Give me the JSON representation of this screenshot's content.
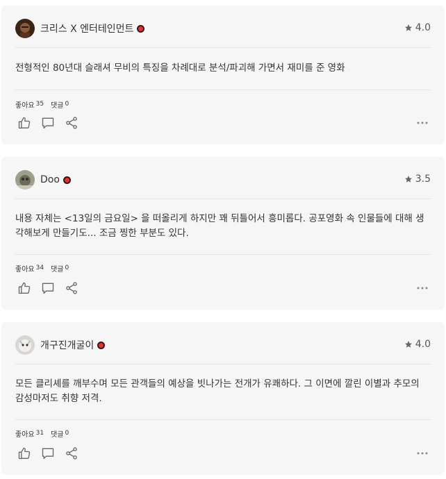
{
  "reviews": [
    {
      "username": "크리스 X 엔터테인먼트",
      "rating": "4.0",
      "text": "전형적인 80년대 슬래셔 무비의 특징을 차례대로 분석/파괴해 가면서 재미를 준 영화",
      "likes_label": "좋아요",
      "likes": "35",
      "comments_label": "댓글",
      "comments": "0"
    },
    {
      "username": "Doo",
      "rating": "3.5",
      "text": "내용 자체는 <13일의 금요일> 을 떠올리게 하지만 꽤 뒤틀어서 흥미롭다. 공포영화 속 인물들에 대해 생각해보게 만들기도... 조금 찡한 부분도 있다.",
      "likes_label": "좋아요",
      "likes": "34",
      "comments_label": "댓글",
      "comments": "0"
    },
    {
      "username": "개구진개굴이",
      "rating": "4.0",
      "text": "모든 클리셰를 깨부수며 모든 관객들의 예상을 빗나가는 전개가 유쾌하다. 그 이면에 깔린 이별과 추모의 감성마저도 취향 저격.",
      "likes_label": "좋아요",
      "likes": "31",
      "comments_label": "댓글",
      "comments": "0"
    }
  ],
  "icons": {
    "star": "star-icon",
    "like": "thumbs-up-icon",
    "comment": "comment-icon",
    "share": "share-icon",
    "more": "more-icon",
    "badge": "verified-badge-icon"
  },
  "colors": {
    "card_bg": "#f6f6f7",
    "badge_red": "#e5303a",
    "icon_gray": "#666666"
  }
}
